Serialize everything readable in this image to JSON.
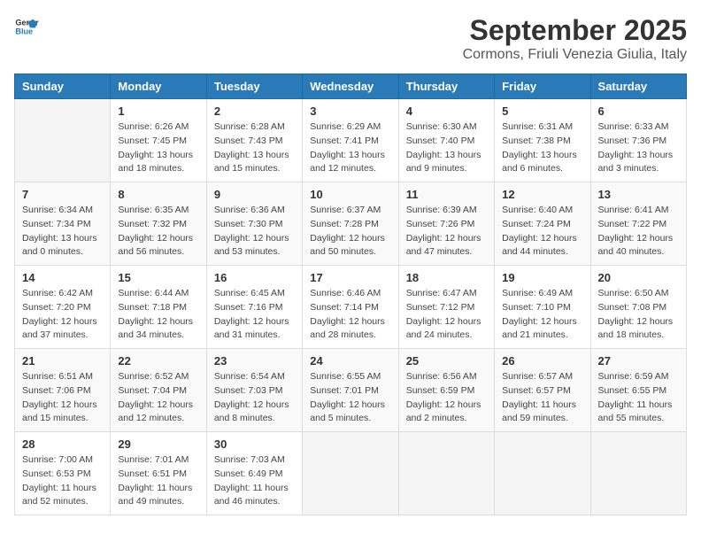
{
  "header": {
    "logo_general": "General",
    "logo_blue": "Blue",
    "month_title": "September 2025",
    "location": "Cormons, Friuli Venezia Giulia, Italy"
  },
  "days_of_week": [
    "Sunday",
    "Monday",
    "Tuesday",
    "Wednesday",
    "Thursday",
    "Friday",
    "Saturday"
  ],
  "weeks": [
    [
      {
        "day": "",
        "info": ""
      },
      {
        "day": "1",
        "info": "Sunrise: 6:26 AM\nSunset: 7:45 PM\nDaylight: 13 hours\nand 18 minutes."
      },
      {
        "day": "2",
        "info": "Sunrise: 6:28 AM\nSunset: 7:43 PM\nDaylight: 13 hours\nand 15 minutes."
      },
      {
        "day": "3",
        "info": "Sunrise: 6:29 AM\nSunset: 7:41 PM\nDaylight: 13 hours\nand 12 minutes."
      },
      {
        "day": "4",
        "info": "Sunrise: 6:30 AM\nSunset: 7:40 PM\nDaylight: 13 hours\nand 9 minutes."
      },
      {
        "day": "5",
        "info": "Sunrise: 6:31 AM\nSunset: 7:38 PM\nDaylight: 13 hours\nand 6 minutes."
      },
      {
        "day": "6",
        "info": "Sunrise: 6:33 AM\nSunset: 7:36 PM\nDaylight: 13 hours\nand 3 minutes."
      }
    ],
    [
      {
        "day": "7",
        "info": "Sunrise: 6:34 AM\nSunset: 7:34 PM\nDaylight: 13 hours\nand 0 minutes."
      },
      {
        "day": "8",
        "info": "Sunrise: 6:35 AM\nSunset: 7:32 PM\nDaylight: 12 hours\nand 56 minutes."
      },
      {
        "day": "9",
        "info": "Sunrise: 6:36 AM\nSunset: 7:30 PM\nDaylight: 12 hours\nand 53 minutes."
      },
      {
        "day": "10",
        "info": "Sunrise: 6:37 AM\nSunset: 7:28 PM\nDaylight: 12 hours\nand 50 minutes."
      },
      {
        "day": "11",
        "info": "Sunrise: 6:39 AM\nSunset: 7:26 PM\nDaylight: 12 hours\nand 47 minutes."
      },
      {
        "day": "12",
        "info": "Sunrise: 6:40 AM\nSunset: 7:24 PM\nDaylight: 12 hours\nand 44 minutes."
      },
      {
        "day": "13",
        "info": "Sunrise: 6:41 AM\nSunset: 7:22 PM\nDaylight: 12 hours\nand 40 minutes."
      }
    ],
    [
      {
        "day": "14",
        "info": "Sunrise: 6:42 AM\nSunset: 7:20 PM\nDaylight: 12 hours\nand 37 minutes."
      },
      {
        "day": "15",
        "info": "Sunrise: 6:44 AM\nSunset: 7:18 PM\nDaylight: 12 hours\nand 34 minutes."
      },
      {
        "day": "16",
        "info": "Sunrise: 6:45 AM\nSunset: 7:16 PM\nDaylight: 12 hours\nand 31 minutes."
      },
      {
        "day": "17",
        "info": "Sunrise: 6:46 AM\nSunset: 7:14 PM\nDaylight: 12 hours\nand 28 minutes."
      },
      {
        "day": "18",
        "info": "Sunrise: 6:47 AM\nSunset: 7:12 PM\nDaylight: 12 hours\nand 24 minutes."
      },
      {
        "day": "19",
        "info": "Sunrise: 6:49 AM\nSunset: 7:10 PM\nDaylight: 12 hours\nand 21 minutes."
      },
      {
        "day": "20",
        "info": "Sunrise: 6:50 AM\nSunset: 7:08 PM\nDaylight: 12 hours\nand 18 minutes."
      }
    ],
    [
      {
        "day": "21",
        "info": "Sunrise: 6:51 AM\nSunset: 7:06 PM\nDaylight: 12 hours\nand 15 minutes."
      },
      {
        "day": "22",
        "info": "Sunrise: 6:52 AM\nSunset: 7:04 PM\nDaylight: 12 hours\nand 12 minutes."
      },
      {
        "day": "23",
        "info": "Sunrise: 6:54 AM\nSunset: 7:03 PM\nDaylight: 12 hours\nand 8 minutes."
      },
      {
        "day": "24",
        "info": "Sunrise: 6:55 AM\nSunset: 7:01 PM\nDaylight: 12 hours\nand 5 minutes."
      },
      {
        "day": "25",
        "info": "Sunrise: 6:56 AM\nSunset: 6:59 PM\nDaylight: 12 hours\nand 2 minutes."
      },
      {
        "day": "26",
        "info": "Sunrise: 6:57 AM\nSunset: 6:57 PM\nDaylight: 11 hours\nand 59 minutes."
      },
      {
        "day": "27",
        "info": "Sunrise: 6:59 AM\nSunset: 6:55 PM\nDaylight: 11 hours\nand 55 minutes."
      }
    ],
    [
      {
        "day": "28",
        "info": "Sunrise: 7:00 AM\nSunset: 6:53 PM\nDaylight: 11 hours\nand 52 minutes."
      },
      {
        "day": "29",
        "info": "Sunrise: 7:01 AM\nSunset: 6:51 PM\nDaylight: 11 hours\nand 49 minutes."
      },
      {
        "day": "30",
        "info": "Sunrise: 7:03 AM\nSunset: 6:49 PM\nDaylight: 11 hours\nand 46 minutes."
      },
      {
        "day": "",
        "info": ""
      },
      {
        "day": "",
        "info": ""
      },
      {
        "day": "",
        "info": ""
      },
      {
        "day": "",
        "info": ""
      }
    ]
  ]
}
